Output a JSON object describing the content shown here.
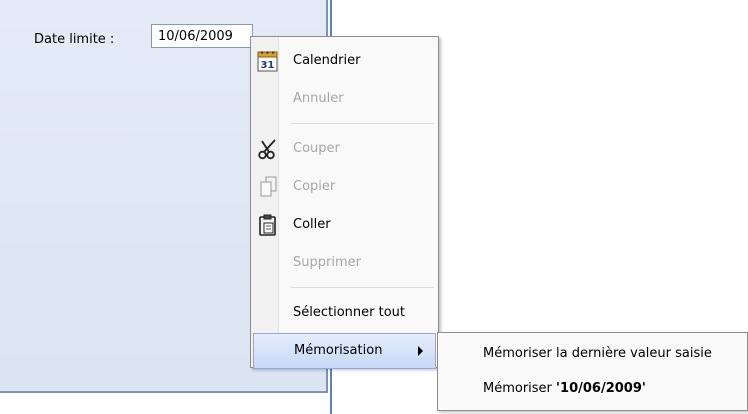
{
  "form": {
    "date_label": "Date limite :",
    "date_value": "10/06/2009"
  },
  "context_menu": {
    "calendrier": "Calendrier",
    "annuler": "Annuler",
    "couper": "Couper",
    "copier": "Copier",
    "coller": "Coller",
    "supprimer": "Supprimer",
    "selectionner_tout": "Sélectionner tout",
    "memorisation": "Mémorisation",
    "calendar_icon_day": "31"
  },
  "submenu": {
    "memoriser_derniere": "Mémoriser la dernière valeur saisie",
    "memoriser_prefix": "Mémoriser ",
    "memoriser_value": "'10/06/2009'"
  },
  "icons": {
    "calendrier": "calendar-icon",
    "couper": "scissors-icon",
    "copier": "copy-icon",
    "coller": "clipboard-icon"
  },
  "colors": {
    "panel_bg": "#e4ebf6",
    "panel_border": "#5e7fbd",
    "menu_bg": "#f9f9f9",
    "hover_bg": "#c6d8f6",
    "disabled_text": "#a7a7a7"
  }
}
